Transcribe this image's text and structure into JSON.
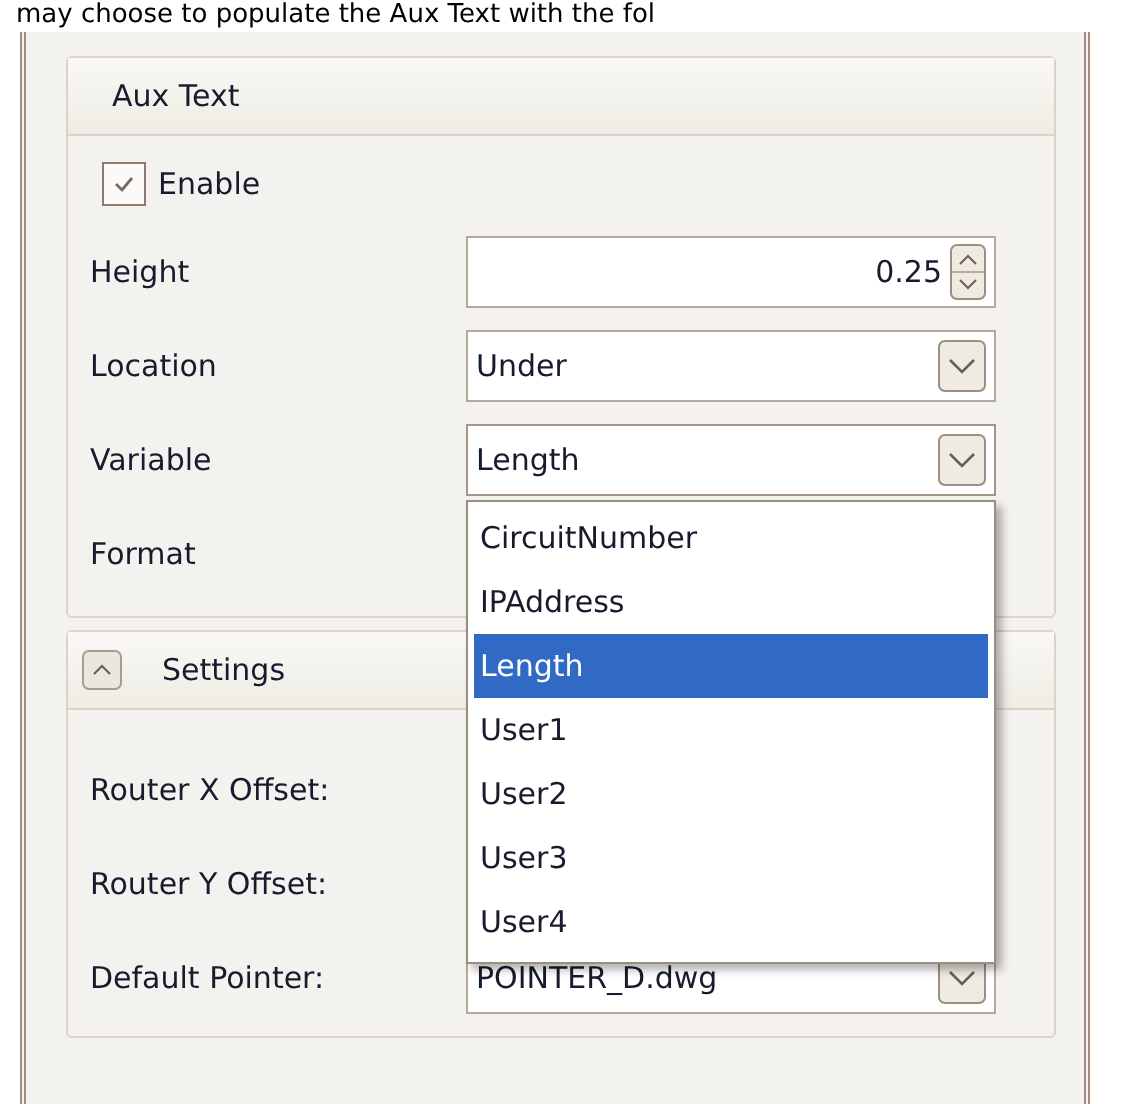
{
  "intro_text": "may choose to populate the Aux Text with the fol",
  "aux_text": {
    "title": "Aux Text",
    "enable": {
      "label": "Enable",
      "checked": true
    },
    "fields": [
      {
        "kind": "spin",
        "label": "Height",
        "value": "0.25"
      },
      {
        "kind": "combo",
        "label": "Location",
        "value": "Under"
      },
      {
        "kind": "combo",
        "label": "Variable",
        "value": "Length",
        "open": true
      },
      {
        "kind": "covered",
        "label": "Format"
      }
    ],
    "dropdown_items": [
      {
        "label": "CircuitNumber",
        "selected": false
      },
      {
        "label": "IPAddress",
        "selected": false
      },
      {
        "label": "Length",
        "selected": true
      },
      {
        "label": "User1",
        "selected": false
      },
      {
        "label": "User2",
        "selected": false
      },
      {
        "label": "User3",
        "selected": false
      },
      {
        "label": "User4",
        "selected": false
      }
    ]
  },
  "settings": {
    "title": "Settings",
    "expanded": true,
    "fields": [
      {
        "kind": "covered",
        "label": "Router X Offset:"
      },
      {
        "kind": "covered",
        "label": "Router Y Offset:"
      },
      {
        "kind": "combo",
        "label": "Default Pointer:",
        "value": "POINTER_D.dwg"
      }
    ]
  }
}
